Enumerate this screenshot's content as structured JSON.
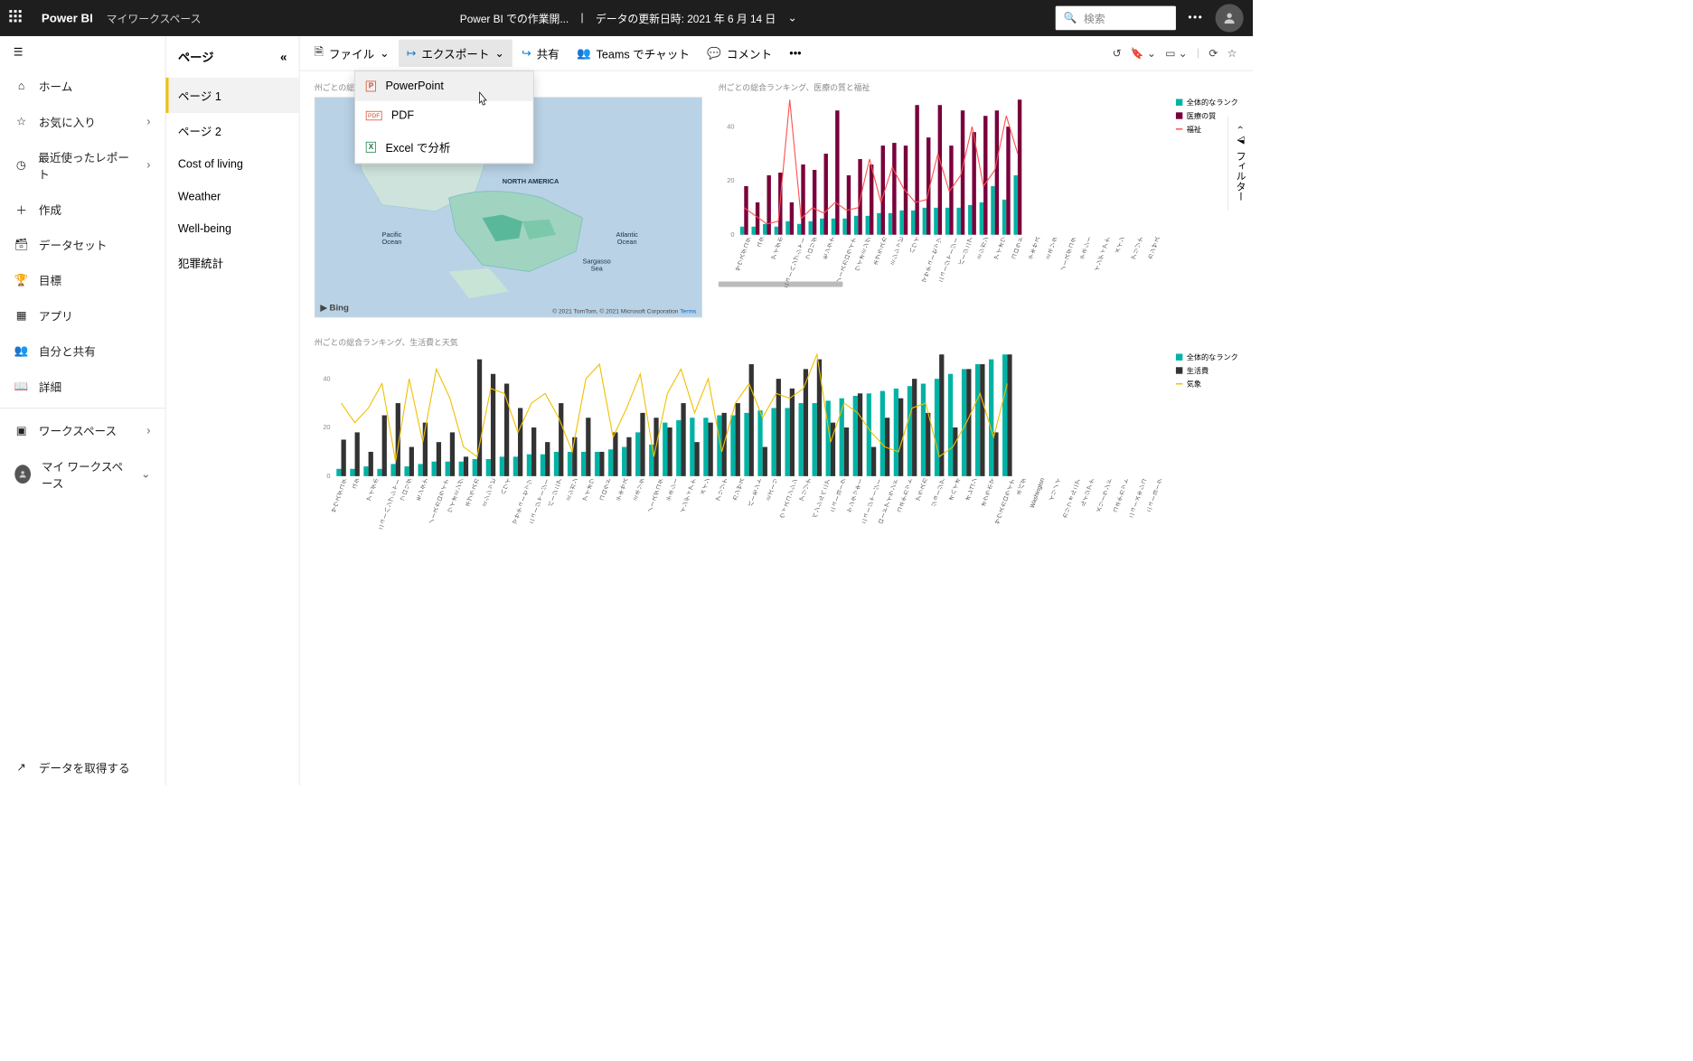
{
  "topbar": {
    "brand": "Power BI",
    "workspace": "マイワークスペース",
    "center_title": "Power BI での作業開...",
    "center_refresh": "データの更新日時: 2021 年 6 月 14 日",
    "search_placeholder": "検索"
  },
  "leftnav": {
    "items": [
      {
        "icon": "home",
        "label": "ホーム"
      },
      {
        "icon": "star",
        "label": "お気に入り",
        "chev": true
      },
      {
        "icon": "clock",
        "label": "最近使ったレポート",
        "chev": true
      },
      {
        "icon": "plus",
        "label": "作成"
      },
      {
        "icon": "dataset",
        "label": "データセット"
      },
      {
        "icon": "trophy",
        "label": "目標"
      },
      {
        "icon": "app",
        "label": "アプリ"
      },
      {
        "icon": "share",
        "label": "自分と共有"
      },
      {
        "icon": "book",
        "label": "詳細"
      }
    ],
    "workspaces_label": "ワークスペース",
    "my_workspace_label": "マイ ワークスペース",
    "get_data_label": "データを取得する"
  },
  "pages": {
    "header": "ページ",
    "items": [
      "ページ 1",
      "ページ 2",
      "Cost of living",
      "Weather",
      "Well-being",
      "犯罪統計"
    ],
    "active_index": 0
  },
  "toolbar": {
    "file": "ファイル",
    "export": "エクスポート",
    "share": "共有",
    "teams": "Teams でチャット",
    "comment": "コメント"
  },
  "export_menu": {
    "powerpoint": "PowerPoint",
    "pdf": "PDF",
    "excel": "Excel で分析"
  },
  "filters_label": "フィルター",
  "map": {
    "title": "州ごとの総合ランキング",
    "labels": {
      "na": "NORTH AMERICA",
      "pacific": "Pacific\nOcean",
      "atlantic": "Atlantic\nOcean",
      "sargasso": "Sargasso\nSea"
    },
    "bing": "Bing",
    "credits": "© 2021 TomTom, © 2021 Microsoft Corporation",
    "terms": "Terms"
  },
  "chart_data": [
    {
      "id": "top_right",
      "type": "bar+line",
      "title": "州ごとの総合ランキング、医療の質と福祉",
      "ylim": [
        0,
        50
      ],
      "yticks": [
        0,
        20,
        40
      ],
      "legend": [
        {
          "name": "全体的なランク",
          "color": "#00b3a4"
        },
        {
          "name": "医療の質",
          "color": "#7a003c"
        },
        {
          "name": "福祉",
          "color": "#ff5050",
          "type": "line"
        }
      ],
      "categories": [
        "サウスダコタ",
        "ユタ",
        "アイダホ",
        "ニューハンプシャー",
        "フロリダ",
        "モンタナ",
        "ノースカロライナ",
        "ワイオミング",
        "ネブラスカ",
        "ミシシッピ",
        "ハワイ",
        "マサチューセッツ",
        "ニュージャージー",
        "バージニア",
        "ミシガン",
        "アイオワ",
        "コロラド",
        "テキサス",
        "ミネソタ",
        "ノースダコタ",
        "テネシー",
        "インディアナ",
        "メイン",
        "アリゾナ",
        "カンザス"
      ],
      "series": [
        {
          "name": "全体的なランク",
          "values": [
            3,
            3,
            4,
            3,
            5,
            4,
            5,
            6,
            6,
            6,
            7,
            7,
            8,
            8,
            9,
            9,
            10,
            10,
            10,
            10,
            11,
            12,
            18,
            13,
            22
          ]
        },
        {
          "name": "医療の質",
          "values": [
            18,
            12,
            22,
            23,
            12,
            26,
            24,
            30,
            46,
            22,
            28,
            26,
            33,
            34,
            33,
            48,
            36,
            48,
            33,
            46,
            38,
            44,
            46,
            40,
            50
          ]
        },
        {
          "name": "福祉",
          "type": "line",
          "values": [
            10,
            7,
            4,
            5,
            50,
            6,
            10,
            8,
            12,
            9,
            10,
            28,
            12,
            25,
            17,
            12,
            13,
            30,
            16,
            22,
            40,
            18,
            24,
            44,
            30
          ]
        }
      ]
    },
    {
      "id": "bottom",
      "type": "bar+line",
      "title": "州ごとの総合ランキング、生活費と天気",
      "ylim": [
        0,
        50
      ],
      "yticks": [
        0,
        20,
        40
      ],
      "legend": [
        {
          "name": "全体的なランク",
          "color": "#00b3a4"
        },
        {
          "name": "生活費",
          "color": "#333333"
        },
        {
          "name": "気象",
          "color": "#f0c000",
          "type": "line"
        }
      ],
      "categories": [
        "サウスダコタ",
        "ユタ",
        "アイダホ",
        "ニューハンプシャー",
        "フロリダ",
        "モンタナ",
        "ノースカロライナ",
        "ワイオミング",
        "ネブラスカ",
        "ミシシッピ",
        "ハワイ",
        "マサチューセッツ",
        "ニュージャージー",
        "バージニア",
        "ミシガン",
        "アイオワ",
        "コロラド",
        "テキサス",
        "ミネソタ",
        "ノースダコタ",
        "テネシー",
        "インディアナ",
        "メイン",
        "アリゾナ",
        "カンザス",
        "バーモント",
        "ミズーリ",
        "ウィスコンシン",
        "アリゾナ",
        "ペンシルベニア",
        "ニューヨーク",
        "ケンタッキー",
        "ニュージャージー",
        "ロードアイランド",
        "コネチカット",
        "アラスカ",
        "ジョージア",
        "オハイオ",
        "オレゴン",
        "オクラホマ",
        "サウスカロライナ",
        "ネバダ",
        "Washington",
        "イリノイ",
        "カリフォルニア",
        "ルイジアナ",
        "メリーランド",
        "コネチカット",
        "ニューメキシコ",
        "ニューヨーク"
      ],
      "series": [
        {
          "name": "全体的なランク",
          "values": [
            3,
            3,
            4,
            3,
            5,
            4,
            5,
            6,
            6,
            6,
            7,
            7,
            8,
            8,
            9,
            9,
            10,
            10,
            10,
            10,
            11,
            12,
            18,
            13,
            22,
            23,
            24,
            24,
            25,
            25,
            26,
            27,
            28,
            28,
            30,
            30,
            31,
            32,
            33,
            34,
            35,
            36,
            37,
            38,
            40,
            42,
            44,
            46,
            48,
            50
          ]
        },
        {
          "name": "生活費",
          "values": [
            15,
            18,
            10,
            25,
            30,
            12,
            22,
            14,
            18,
            8,
            48,
            42,
            38,
            28,
            20,
            14,
            30,
            16,
            24,
            10,
            18,
            16,
            26,
            24,
            20,
            30,
            14,
            22,
            26,
            30,
            46,
            12,
            40,
            36,
            44,
            48,
            22,
            20,
            34,
            12,
            24,
            32,
            40,
            26,
            50,
            20,
            44,
            46,
            18,
            50
          ]
        },
        {
          "name": "気象",
          "type": "line",
          "values": [
            30,
            22,
            28,
            38,
            6,
            40,
            14,
            44,
            32,
            12,
            8,
            36,
            34,
            18,
            30,
            34,
            24,
            10,
            40,
            46,
            16,
            28,
            42,
            8,
            34,
            44,
            26,
            40,
            10,
            30,
            38,
            24,
            34,
            32,
            36,
            50,
            14,
            30,
            26,
            18,
            12,
            10,
            28,
            30,
            8,
            12,
            22,
            34,
            16,
            38
          ]
        }
      ]
    }
  ]
}
